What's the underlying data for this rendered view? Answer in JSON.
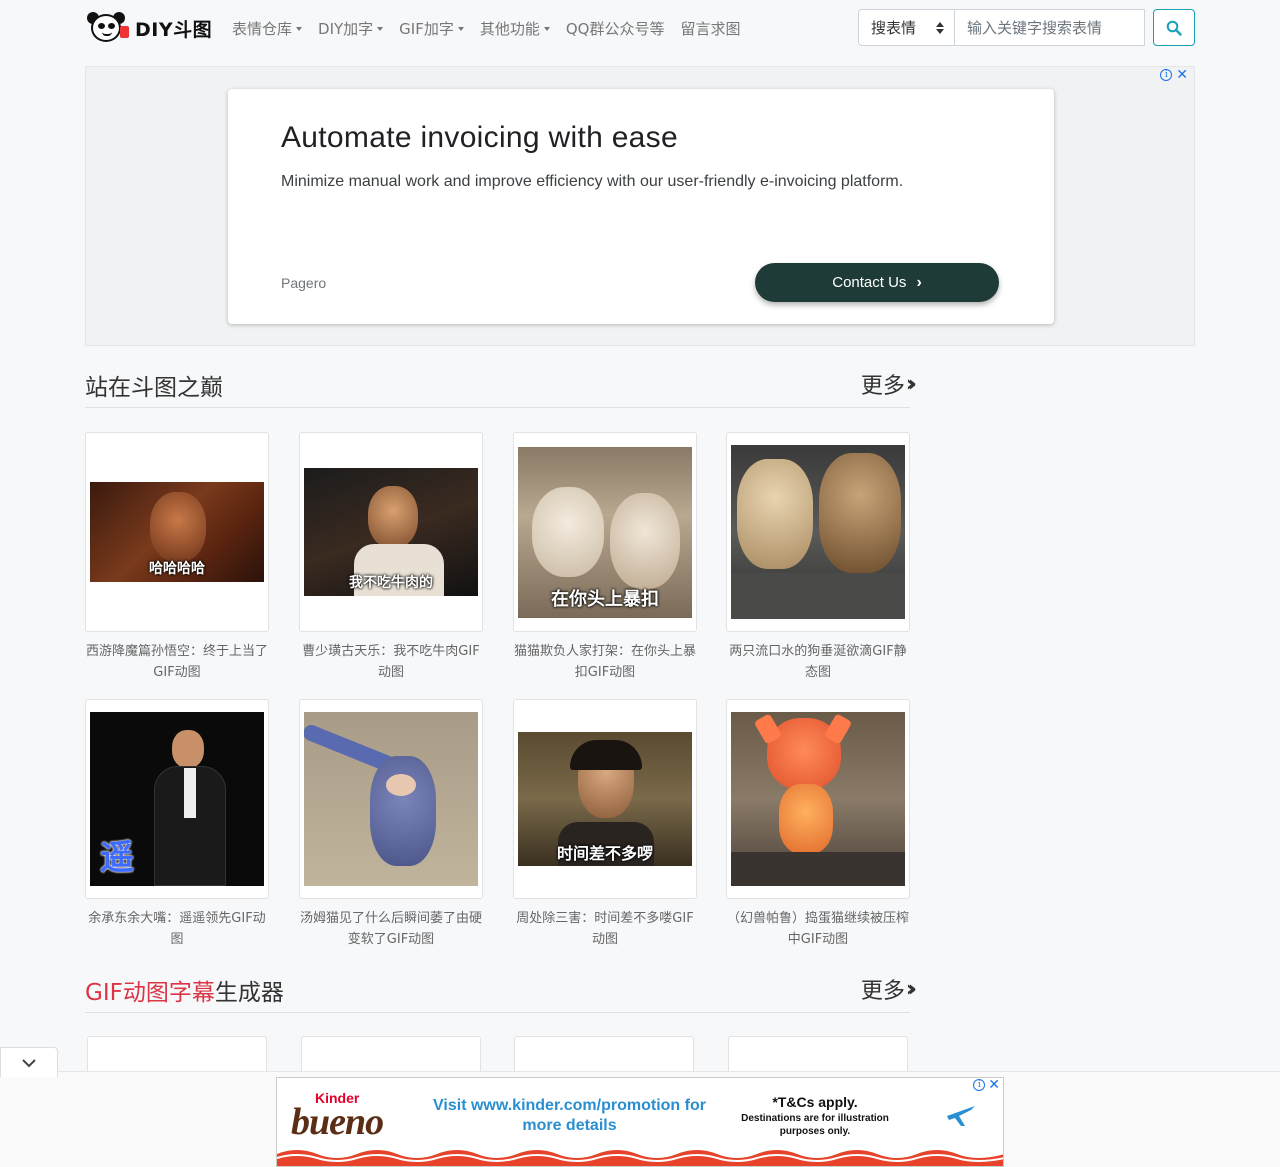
{
  "brand": {
    "name": "DIY斗图"
  },
  "nav": {
    "items": [
      {
        "label": "表情仓库",
        "dropdown": true
      },
      {
        "label": "DIY加字",
        "dropdown": true
      },
      {
        "label": "GIF加字",
        "dropdown": true
      },
      {
        "label": "其他功能",
        "dropdown": true
      },
      {
        "label": "QQ群公众号等",
        "dropdown": false
      },
      {
        "label": "留言求图",
        "dropdown": false
      }
    ]
  },
  "search": {
    "select_value": "搜表情",
    "placeholder": "输入关键字搜索表情",
    "button_icon": "search-icon"
  },
  "ad_top": {
    "title": "Automate invoicing with ease",
    "description": "Minimize manual work and improve efficiency with our user-friendly e-invoicing platform.",
    "source": "Pagero",
    "cta": "Contact Us"
  },
  "sections": [
    {
      "title": "站在斗图之巅",
      "title_red": "",
      "more": "更多",
      "items": [
        {
          "caption": "西游降魔篇孙悟空：终于上当了GIF动图",
          "overlay": "哈哈哈哈"
        },
        {
          "caption": "曹少璜古天乐：我不吃牛肉GIF动图",
          "overlay": "我不吃牛肉的"
        },
        {
          "caption": "猫猫欺负人家打架：在你头上暴扣GIF动图",
          "overlay": "在你头上暴扣"
        },
        {
          "caption": "两只流口水的狗垂涎欲滴GIF静态图",
          "overlay": ""
        },
        {
          "caption": "余承东余大嘴：遥遥领先GIF动图",
          "overlay": "遥"
        },
        {
          "caption": "汤姆猫见了什么后瞬间萎了由硬变软了GIF动图",
          "overlay": ""
        },
        {
          "caption": "周处除三害：时间差不多喽GIF动图",
          "overlay": "时间差不多啰"
        },
        {
          "caption": "（幻兽帕鲁）捣蛋猫继续被压榨中GIF动图",
          "overlay": ""
        }
      ]
    },
    {
      "title": "生成器",
      "title_red": "GIF动图字幕",
      "more": "更多"
    }
  ],
  "ad_bottom": {
    "brand_top": "Kinder",
    "brand": "bueno",
    "message": "Visit www.kinder.com/promotion for more details",
    "tc_title": "*T&Cs apply.",
    "tc_note": "Destinations are for illustration purposes only."
  },
  "colors": {
    "accent": "#17a2b8",
    "red": "#dc3545",
    "cta": "#1f3b37"
  }
}
